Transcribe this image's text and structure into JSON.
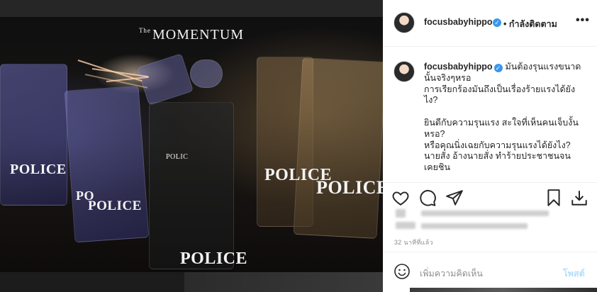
{
  "photo": {
    "watermark_prefix": "The",
    "watermark": "MOMENTUM",
    "shield_labels": [
      "POLICE",
      "PO",
      "POLICE",
      "POLICE",
      "POLICE",
      "POLICE",
      "POLIC"
    ]
  },
  "header": {
    "username": "focusbabyhippo",
    "separator": "•",
    "follow_status": "กำลังติดตาม",
    "more": "•••"
  },
  "caption": {
    "username": "focusbabyhippo",
    "lines": [
      "มันต้องรุนแรงขนาด",
      "นั้นจริงๆหรอ",
      "การเรียกร้องมันถึงเป็นเรื่องร้ายแรงได้ยัง",
      "ไง?",
      "",
      "ยินดีกับความรุนแรง สะใจที่เห็นคนเจ็บงั้น",
      "หรอ?",
      "หรือคุณนิ่งเฉยกับความรุนแรงได้ยังไง?",
      "นายสั่ง อ้างนายสั่ง ทำร้ายประชาชนจน",
      "เคยชิน"
    ]
  },
  "actions": {
    "like_icon": "heart-icon",
    "comment_icon": "comment-icon",
    "share_icon": "share-icon",
    "save_icon": "bookmark-icon",
    "download_icon": "download-icon"
  },
  "meta": {
    "time_ago": "32 นาทีที่แล้ว"
  },
  "comment": {
    "placeholder": "เพิ่มความคิดเห็น",
    "post_label": "โพสต์"
  },
  "colors": {
    "verified": "#3897f0",
    "post_disabled": "#b2dffc",
    "text": "#262626",
    "muted": "#8e8e8e"
  }
}
